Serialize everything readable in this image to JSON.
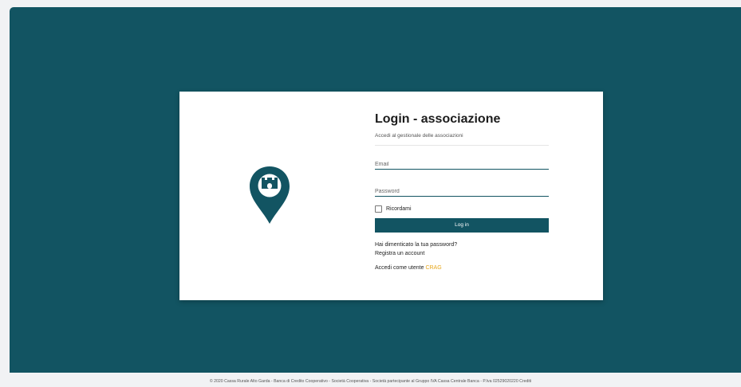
{
  "login": {
    "title": "Login - associazione",
    "subtitle": "Accedi al gestionale delle associazioni",
    "email_placeholder": "Email",
    "password_placeholder": "Password",
    "remember_label": "Ricordami",
    "login_button": "Log in",
    "forgot_password": "Hai dimenticato la tua password?",
    "register": "Registra un account",
    "guest_prefix": "Accedi come utente",
    "guest_brand": "CRAG"
  },
  "footer": {
    "text": "© 2020 Cassa Rurale Alto Garda - Banca di Credito Cooperativo - Società Cooperativa - Società partecipante al Gruppo IVA Cassa Centrale Banca - P.Iva 02529020220 Crediti"
  },
  "colors": {
    "primary": "#125462",
    "accent": "#e8a81e"
  }
}
